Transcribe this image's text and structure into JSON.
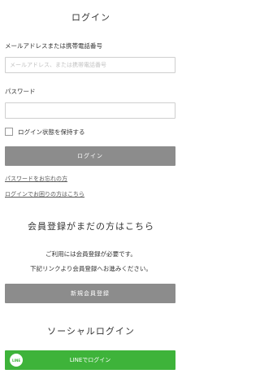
{
  "login": {
    "title": "ログイン",
    "email_label": "メールアドレスまたは携帯電話番号",
    "email_placeholder": "メールアドレス、または携帯電話番号",
    "password_label": "パスワード",
    "remember_label": "ログイン状態を保持する",
    "login_button": "ログイン",
    "forgot_password_link": "パスワードをお忘れの方",
    "trouble_link": "ログインでお困りの方はこちら"
  },
  "register": {
    "heading": "会員登録がまだの方はこちら",
    "desc_line1": "ご利用には会員登録が必要です。",
    "desc_line2": "下記リンクより会員登録へお進みください。",
    "button": "新規会員登録"
  },
  "social": {
    "heading": "ソーシャルログイン",
    "line_button": "LINEでログイン",
    "line_icon_text": "LINE",
    "line_color": "#3eb33a"
  }
}
